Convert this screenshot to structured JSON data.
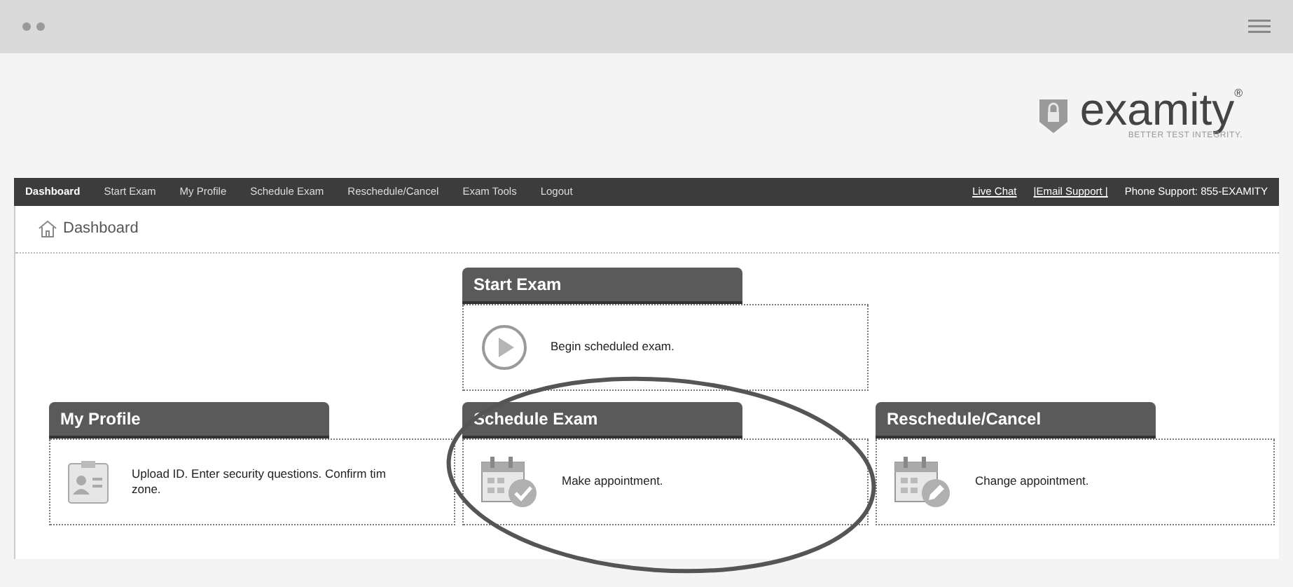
{
  "logo": {
    "name": "examity",
    "mark": "®",
    "tagline": "BETTER TEST INTEGRITY."
  },
  "nav": {
    "items": [
      {
        "label": "Dashboard",
        "selected": true
      },
      {
        "label": "Start Exam",
        "selected": false
      },
      {
        "label": "My Profile",
        "selected": false
      },
      {
        "label": "Schedule Exam",
        "selected": false
      },
      {
        "label": "Reschedule/Cancel",
        "selected": false
      },
      {
        "label": "Exam Tools",
        "selected": false
      },
      {
        "label": "Logout",
        "selected": false
      }
    ],
    "links": [
      "Live Chat",
      "|Email Support |"
    ],
    "phone": "Phone Support: 855-EXAMITY"
  },
  "page_title": "Dashboard",
  "cards": [
    {
      "kind": "play",
      "title": "Start Exam",
      "lines": [
        "Begin scheduled exam."
      ]
    },
    {
      "kind": "profile",
      "title": "My Profile",
      "lines": [
        "Upload ID. Enter security questions. Confirm tim",
        "zone."
      ]
    },
    {
      "kind": "schedule",
      "title": "Schedule Exam",
      "lines": [
        "Make appointment."
      ]
    },
    {
      "kind": "reschedule",
      "title": "Reschedule/Cancel",
      "lines": [
        "Change appointment."
      ]
    }
  ],
  "annotation": {
    "kind": "circle"
  }
}
